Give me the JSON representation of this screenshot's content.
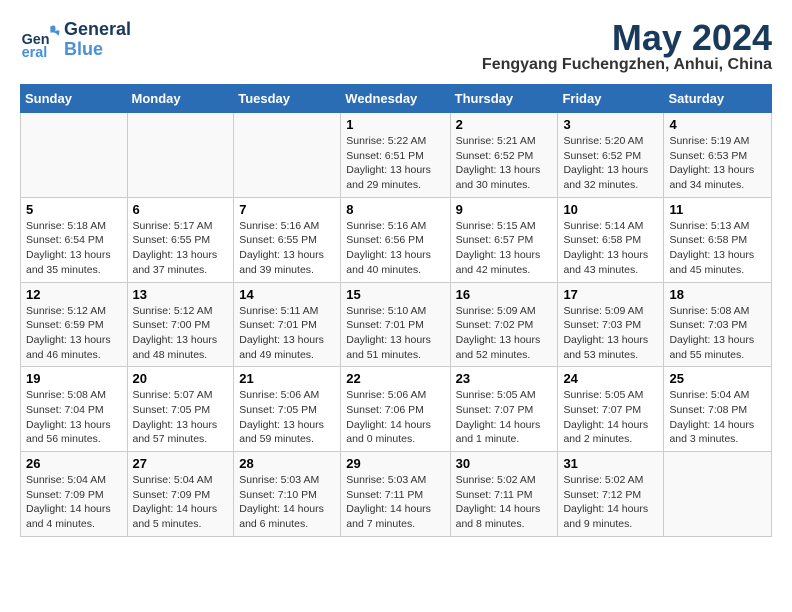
{
  "header": {
    "logo_general": "General",
    "logo_blue": "Blue",
    "month_title": "May 2024",
    "subtitle": "Fengyang Fuchengzhen, Anhui, China"
  },
  "weekdays": [
    "Sunday",
    "Monday",
    "Tuesday",
    "Wednesday",
    "Thursday",
    "Friday",
    "Saturday"
  ],
  "weeks": [
    [
      {
        "day": "",
        "info": ""
      },
      {
        "day": "",
        "info": ""
      },
      {
        "day": "",
        "info": ""
      },
      {
        "day": "1",
        "info": "Sunrise: 5:22 AM\nSunset: 6:51 PM\nDaylight: 13 hours and 29 minutes."
      },
      {
        "day": "2",
        "info": "Sunrise: 5:21 AM\nSunset: 6:52 PM\nDaylight: 13 hours and 30 minutes."
      },
      {
        "day": "3",
        "info": "Sunrise: 5:20 AM\nSunset: 6:52 PM\nDaylight: 13 hours and 32 minutes."
      },
      {
        "day": "4",
        "info": "Sunrise: 5:19 AM\nSunset: 6:53 PM\nDaylight: 13 hours and 34 minutes."
      }
    ],
    [
      {
        "day": "5",
        "info": "Sunrise: 5:18 AM\nSunset: 6:54 PM\nDaylight: 13 hours and 35 minutes."
      },
      {
        "day": "6",
        "info": "Sunrise: 5:17 AM\nSunset: 6:55 PM\nDaylight: 13 hours and 37 minutes."
      },
      {
        "day": "7",
        "info": "Sunrise: 5:16 AM\nSunset: 6:55 PM\nDaylight: 13 hours and 39 minutes."
      },
      {
        "day": "8",
        "info": "Sunrise: 5:16 AM\nSunset: 6:56 PM\nDaylight: 13 hours and 40 minutes."
      },
      {
        "day": "9",
        "info": "Sunrise: 5:15 AM\nSunset: 6:57 PM\nDaylight: 13 hours and 42 minutes."
      },
      {
        "day": "10",
        "info": "Sunrise: 5:14 AM\nSunset: 6:58 PM\nDaylight: 13 hours and 43 minutes."
      },
      {
        "day": "11",
        "info": "Sunrise: 5:13 AM\nSunset: 6:58 PM\nDaylight: 13 hours and 45 minutes."
      }
    ],
    [
      {
        "day": "12",
        "info": "Sunrise: 5:12 AM\nSunset: 6:59 PM\nDaylight: 13 hours and 46 minutes."
      },
      {
        "day": "13",
        "info": "Sunrise: 5:12 AM\nSunset: 7:00 PM\nDaylight: 13 hours and 48 minutes."
      },
      {
        "day": "14",
        "info": "Sunrise: 5:11 AM\nSunset: 7:01 PM\nDaylight: 13 hours and 49 minutes."
      },
      {
        "day": "15",
        "info": "Sunrise: 5:10 AM\nSunset: 7:01 PM\nDaylight: 13 hours and 51 minutes."
      },
      {
        "day": "16",
        "info": "Sunrise: 5:09 AM\nSunset: 7:02 PM\nDaylight: 13 hours and 52 minutes."
      },
      {
        "day": "17",
        "info": "Sunrise: 5:09 AM\nSunset: 7:03 PM\nDaylight: 13 hours and 53 minutes."
      },
      {
        "day": "18",
        "info": "Sunrise: 5:08 AM\nSunset: 7:03 PM\nDaylight: 13 hours and 55 minutes."
      }
    ],
    [
      {
        "day": "19",
        "info": "Sunrise: 5:08 AM\nSunset: 7:04 PM\nDaylight: 13 hours and 56 minutes."
      },
      {
        "day": "20",
        "info": "Sunrise: 5:07 AM\nSunset: 7:05 PM\nDaylight: 13 hours and 57 minutes."
      },
      {
        "day": "21",
        "info": "Sunrise: 5:06 AM\nSunset: 7:05 PM\nDaylight: 13 hours and 59 minutes."
      },
      {
        "day": "22",
        "info": "Sunrise: 5:06 AM\nSunset: 7:06 PM\nDaylight: 14 hours and 0 minutes."
      },
      {
        "day": "23",
        "info": "Sunrise: 5:05 AM\nSunset: 7:07 PM\nDaylight: 14 hours and 1 minute."
      },
      {
        "day": "24",
        "info": "Sunrise: 5:05 AM\nSunset: 7:07 PM\nDaylight: 14 hours and 2 minutes."
      },
      {
        "day": "25",
        "info": "Sunrise: 5:04 AM\nSunset: 7:08 PM\nDaylight: 14 hours and 3 minutes."
      }
    ],
    [
      {
        "day": "26",
        "info": "Sunrise: 5:04 AM\nSunset: 7:09 PM\nDaylight: 14 hours and 4 minutes."
      },
      {
        "day": "27",
        "info": "Sunrise: 5:04 AM\nSunset: 7:09 PM\nDaylight: 14 hours and 5 minutes."
      },
      {
        "day": "28",
        "info": "Sunrise: 5:03 AM\nSunset: 7:10 PM\nDaylight: 14 hours and 6 minutes."
      },
      {
        "day": "29",
        "info": "Sunrise: 5:03 AM\nSunset: 7:11 PM\nDaylight: 14 hours and 7 minutes."
      },
      {
        "day": "30",
        "info": "Sunrise: 5:02 AM\nSunset: 7:11 PM\nDaylight: 14 hours and 8 minutes."
      },
      {
        "day": "31",
        "info": "Sunrise: 5:02 AM\nSunset: 7:12 PM\nDaylight: 14 hours and 9 minutes."
      },
      {
        "day": "",
        "info": ""
      }
    ]
  ]
}
